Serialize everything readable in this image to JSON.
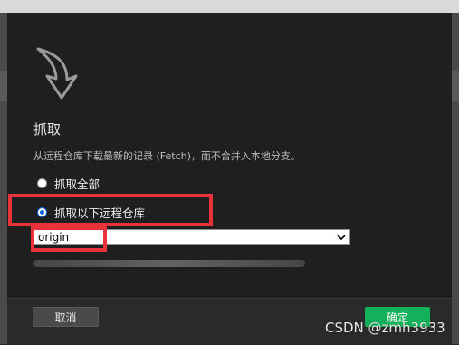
{
  "dialog": {
    "title": "抓取",
    "description": "从远程仓库下载最新的记录 (Fetch)，而不合并入本地分支。",
    "options": [
      {
        "label": "抓取全部",
        "checked": false
      },
      {
        "label": "抓取以下远程仓库",
        "checked": true
      }
    ],
    "remote_select": {
      "value": "origin"
    },
    "buttons": {
      "cancel": "取消",
      "ok": "确定"
    }
  },
  "watermark": "CSDN @zmh3933",
  "colors": {
    "highlight": "#e8333a",
    "ok_button": "#13b25a",
    "radio_accent": "#0a64d8"
  }
}
